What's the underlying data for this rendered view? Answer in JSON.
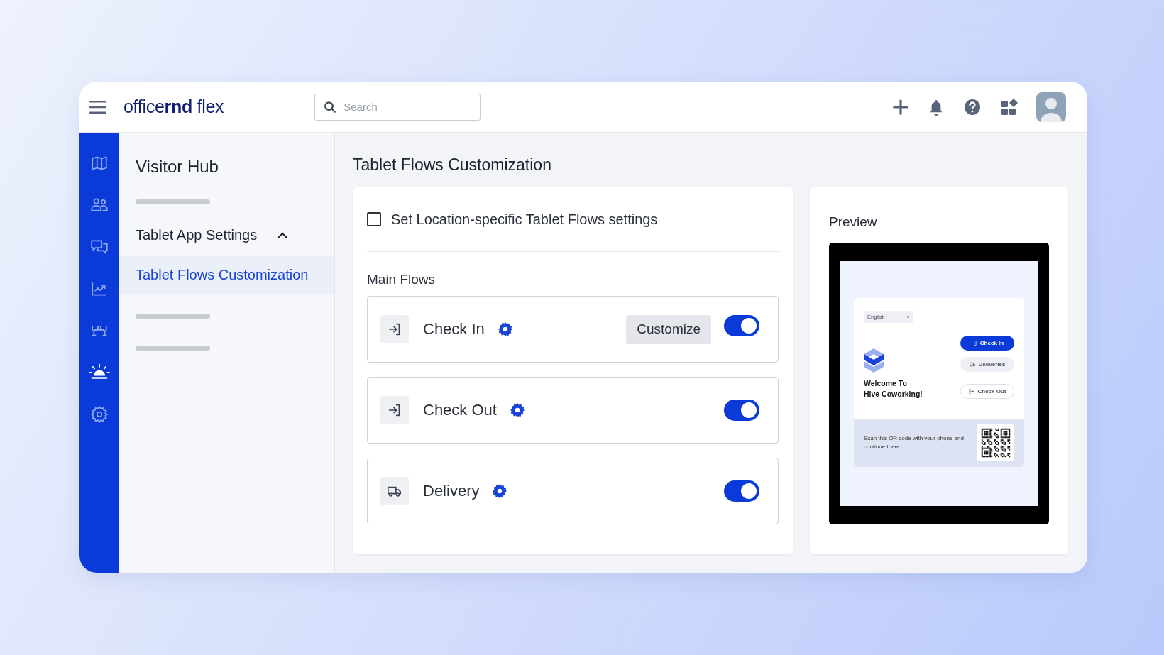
{
  "topbar": {
    "logo": "office**rnd** flex",
    "search": {
      "placeholder": "Search"
    }
  },
  "rail": [
    {
      "kind": "map",
      "selected": false
    },
    {
      "kind": "people",
      "selected": false
    },
    {
      "kind": "chat",
      "selected": false
    },
    {
      "kind": "chart",
      "selected": false
    },
    {
      "kind": "desk",
      "selected": false
    },
    {
      "kind": "bell",
      "selected": true
    },
    {
      "kind": "gear",
      "selected": false
    }
  ],
  "nav": {
    "title": "Visitor Hub",
    "items": [
      {
        "kind": "skeleton"
      },
      {
        "kind": "group",
        "label": "Tablet App Settings",
        "expanded": true,
        "children": [
          {
            "label": "Tablet Flows Customization",
            "selected": true
          }
        ]
      },
      {
        "kind": "skeleton"
      },
      {
        "kind": "skeleton"
      }
    ]
  },
  "page": {
    "title": "Tablet Flows Customization"
  },
  "settings": {
    "location_specific": {
      "label": "Set Location-specific Tablet Flows settings",
      "checked": false
    },
    "section": "Main Flows",
    "flows": [
      {
        "label": "Check In",
        "kind": "check-in",
        "action": "Customize",
        "on": true
      },
      {
        "label": "Check Out",
        "kind": "check-out",
        "on": true
      },
      {
        "label": "Delivery",
        "kind": "delivery",
        "on": true
      }
    ]
  },
  "preview": {
    "title": "Preview",
    "language": "English",
    "welcome": [
      "Welcome To",
      "Hive Coworking!"
    ],
    "buttons": [
      {
        "kind": "primary",
        "label": "Check In"
      },
      {
        "kind": "secondary",
        "label": "Deliveries"
      },
      {
        "kind": "outline",
        "label": "Check Out"
      }
    ],
    "qr_text": "Scan this QR code with your phone and continue there."
  }
}
